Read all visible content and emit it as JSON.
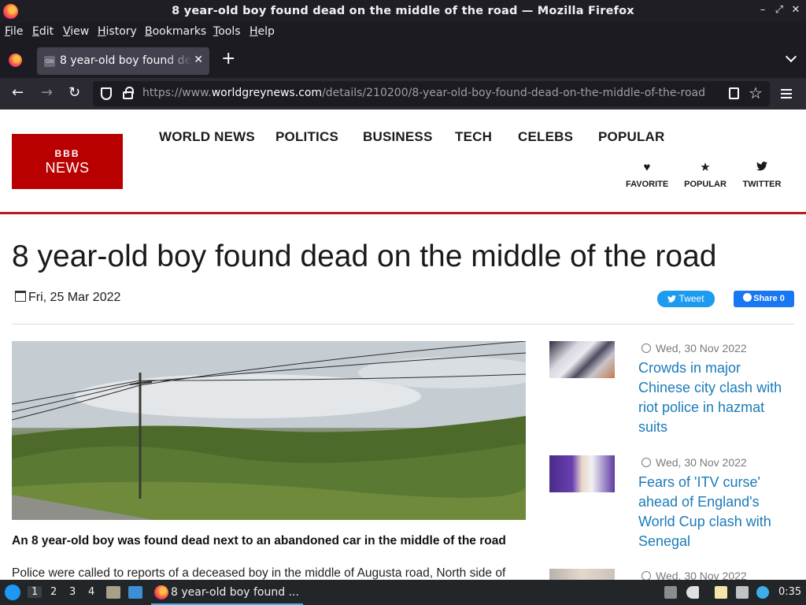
{
  "window": {
    "title": "8 year-old boy found dead on the middle of the road — Mozilla Firefox",
    "controls": {
      "minimize": "–",
      "restore": "⤢",
      "close": "✕"
    }
  },
  "menu": [
    "File",
    "Edit",
    "View",
    "History",
    "Bookmarks",
    "Tools",
    "Help"
  ],
  "tabs": [
    {
      "favicon_text": "GN",
      "label": "8 year-old boy found dead on the middle of the road",
      "close": "✕"
    }
  ],
  "tabbar": {
    "new_tab": "+"
  },
  "nav": {
    "back": "←",
    "forward": "→",
    "reload": "↻",
    "url_prefix": "https://www.",
    "url_domain": "worldgreynews.com",
    "url_path": "/details/210200/8-year-old-boy-found-dead-on-the-middle-of-the-road",
    "bookmark_star": "☆"
  },
  "site": {
    "logo_top": "BBB",
    "logo_bottom": "NEWS",
    "nav_links": [
      "WORLD NEWS",
      "POLITICS",
      "BUSINESS",
      "TECH",
      "CELEBS",
      "POPULAR"
    ],
    "icon_links": [
      {
        "icon": "heart-icon",
        "glyph": "♥",
        "label": "FAVORITE"
      },
      {
        "icon": "star-icon",
        "glyph": "★",
        "label": "POPULAR"
      },
      {
        "icon": "twitter-icon",
        "glyph": "🐦",
        "label": "TWITTER"
      }
    ],
    "accent_color": "#bb1919"
  },
  "article": {
    "headline": "8 year-old boy found dead on the middle of the road",
    "date": "Fri, 25 Mar 2022",
    "tweet_label": "Tweet",
    "share_label": "Share 0",
    "caption": "An 8 year-old boy was found dead next to an abandoned car in the middle of the road",
    "body_start": "Police were called to reports of a deceased boy in the middle of Augusta road, North side of"
  },
  "sidebar": [
    {
      "date": "Wed, 30 Nov 2022",
      "title": "Crowds in major Chinese city clash with riot police in hazmat suits"
    },
    {
      "date": "Wed, 30 Nov 2022",
      "title": "Fears of 'ITV curse' ahead of England's World Cup clash with Senegal"
    },
    {
      "date": "Wed, 30 Nov 2022",
      "title": ""
    }
  ],
  "taskbar": {
    "workspaces": [
      "1",
      "2",
      "3",
      "4"
    ],
    "task_label": "8 year-old boy found ...",
    "clock": "0:35"
  }
}
